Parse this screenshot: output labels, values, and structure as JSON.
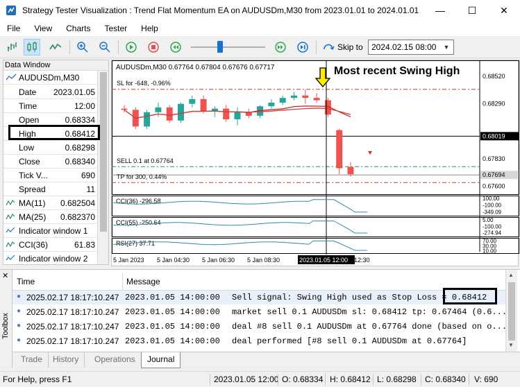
{
  "window": {
    "title": "Strategy Tester Visualization : Trend Flat Momentum EA on AUDUSDm,M30 from 2023.01.01 to 2024.01.01",
    "minimize": "—",
    "maximize": "☐",
    "close": "✕"
  },
  "menu": [
    "File",
    "View",
    "Charts",
    "Tester",
    "Help"
  ],
  "toolbar": {
    "skip_label": "Skip to",
    "skip_value": "2024.02.15 08:00",
    "icons": [
      "indicators-icon",
      "candles-icon",
      "line-chart-icon",
      "zoom-in-icon",
      "zoom-out-icon",
      "play-icon",
      "stop-icon",
      "rewind-icon",
      "fast-forward-icon",
      "skip-end-icon",
      "skip-to-icon"
    ]
  },
  "data_window": {
    "title": "Data Window",
    "symbol": "AUDUSDm,M30",
    "rows": [
      {
        "label": "Date",
        "value": "2023.01.05"
      },
      {
        "label": "Time",
        "value": "12:00"
      },
      {
        "label": "Open",
        "value": "0.68334"
      },
      {
        "label": "High",
        "value": "0.68412"
      },
      {
        "label": "Low",
        "value": "0.68298"
      },
      {
        "label": "Close",
        "value": "0.68340"
      },
      {
        "label": "Tick V...",
        "value": "690"
      },
      {
        "label": "Spread",
        "value": "11"
      },
      {
        "label": "MA(11)",
        "value": "0.682504"
      },
      {
        "label": "MA(25)",
        "value": "0.682370"
      },
      {
        "label": "Indicator window 1",
        "value": ""
      },
      {
        "label": "CCI(36)",
        "value": "61.83"
      },
      {
        "label": "Indicator window 2",
        "value": ""
      }
    ]
  },
  "chart": {
    "header": "AUDUSDm,M30  0.67764 0.67804 0.67676 0.67717",
    "annotation": "Most recent Swing High",
    "sl_label": "SL for -648, -0.96%",
    "sell_label": "SELL 0.1 at 0.67764",
    "tp_label": "TP for 300, 0.44%",
    "price_labels": [
      "0.68520",
      "0.68290",
      "0.68019",
      "0.67830",
      "0.67694",
      "0.67600"
    ],
    "cci1_label": "CCI(36) -296.58",
    "cci1_ticks": [
      "100.00",
      "-100.00",
      "-349.09"
    ],
    "cci2_label": "CCI(55) -250.64",
    "cci2_ticks": [
      "5.00",
      "-100.00",
      "-274.94"
    ],
    "rsi_label": "RSI(27) 37.71",
    "rsi_ticks": [
      "70.00",
      "30.00",
      "10.00"
    ],
    "time_labels": [
      "5 Jan 2023",
      "5 Jan 04:30",
      "5 Jan 06:30",
      "5 Jan 08:30",
      "2023.01.05 12:00",
      "12:30"
    ]
  },
  "chart_data": {
    "type": "candlestick",
    "title": "AUDUSDm,M30",
    "price_range": [
      0.6755,
      0.6862
    ],
    "levels": {
      "sl": 0.68412,
      "crosshair": 0.68019,
      "sell": 0.67764,
      "bid": 0.67694,
      "tp": 0.6763
    },
    "candles": [
      {
        "o": 0.6825,
        "h": 0.6828,
        "l": 0.6822,
        "c": 0.6824
      },
      {
        "o": 0.6824,
        "h": 0.6826,
        "l": 0.6808,
        "c": 0.681
      },
      {
        "o": 0.681,
        "h": 0.6824,
        "l": 0.6808,
        "c": 0.6822
      },
      {
        "o": 0.6822,
        "h": 0.683,
        "l": 0.6818,
        "c": 0.6826
      },
      {
        "o": 0.6826,
        "h": 0.6828,
        "l": 0.6813,
        "c": 0.6815
      },
      {
        "o": 0.6815,
        "h": 0.683,
        "l": 0.6813,
        "c": 0.6829
      },
      {
        "o": 0.6829,
        "h": 0.6836,
        "l": 0.6826,
        "c": 0.6833
      },
      {
        "o": 0.6833,
        "h": 0.6836,
        "l": 0.6821,
        "c": 0.6823
      },
      {
        "o": 0.6823,
        "h": 0.6827,
        "l": 0.6818,
        "c": 0.6825
      },
      {
        "o": 0.6825,
        "h": 0.6828,
        "l": 0.6814,
        "c": 0.6816
      },
      {
        "o": 0.6816,
        "h": 0.6826,
        "l": 0.6811,
        "c": 0.6822
      },
      {
        "o": 0.6822,
        "h": 0.6825,
        "l": 0.6817,
        "c": 0.6819
      },
      {
        "o": 0.6819,
        "h": 0.6828,
        "l": 0.6817,
        "c": 0.6827
      },
      {
        "o": 0.6827,
        "h": 0.6833,
        "l": 0.6825,
        "c": 0.683
      },
      {
        "o": 0.683,
        "h": 0.6836,
        "l": 0.6828,
        "c": 0.6834
      },
      {
        "o": 0.6834,
        "h": 0.6839,
        "l": 0.6832,
        "c": 0.6836
      },
      {
        "o": 0.6836,
        "h": 0.6841,
        "l": 0.6829,
        "c": 0.6834
      },
      {
        "o": 0.6834,
        "h": 0.6838,
        "l": 0.683,
        "c": 0.6832
      },
      {
        "o": 0.6832,
        "h": 0.6834,
        "l": 0.6818,
        "c": 0.682
      },
      {
        "o": 0.6807,
        "h": 0.6808,
        "l": 0.677,
        "c": 0.6775
      },
      {
        "o": 0.6776,
        "h": 0.678,
        "l": 0.6768,
        "c": 0.677
      }
    ]
  },
  "journal": {
    "col_time": "Time",
    "col_message": "Message",
    "rows": [
      {
        "time": "2025.02.17 18:17:10.247",
        "date": "2023.01.05 14:00:00",
        "msg": "Sell signal: Swing High used as Stop Loss = 0.68412"
      },
      {
        "time": "2025.02.17 18:17:10.247",
        "date": "2023.01.05 14:00:00",
        "msg": "market sell 0.1 AUDUSDm sl: 0.68412 tp: 0.67464 (0.6..."
      },
      {
        "time": "2025.02.17 18:17:10.247",
        "date": "2023.01.05 14:00:00",
        "msg": "deal #8 sell 0.1 AUDUSDm at 0.67764 done (based on o..."
      },
      {
        "time": "2025.02.17 18:17:10.247",
        "date": "2023.01.05 14:00:00",
        "msg": "deal performed [#8 sell 0.1 AUDUSDm at 0.67764]"
      },
      {
        "time": "2025.02.17 18:17:10.247",
        "date": "2023.01.05 14:00:00",
        "msg": "order performed sell 0.1 at 0.67764 [#8 sell 0.1 AUD..."
      }
    ]
  },
  "tabs": [
    "Trade",
    "History",
    "Operations",
    "Journal"
  ],
  "toolbox_label": "Toolbox",
  "status": {
    "help": "For Help, press F1",
    "date": "2023.01.05 12:00",
    "open": "O: 0.68334",
    "high": "H: 0.68412",
    "low": "L: 0.68298",
    "close": "C: 0.68340",
    "volume": "V: 690"
  }
}
